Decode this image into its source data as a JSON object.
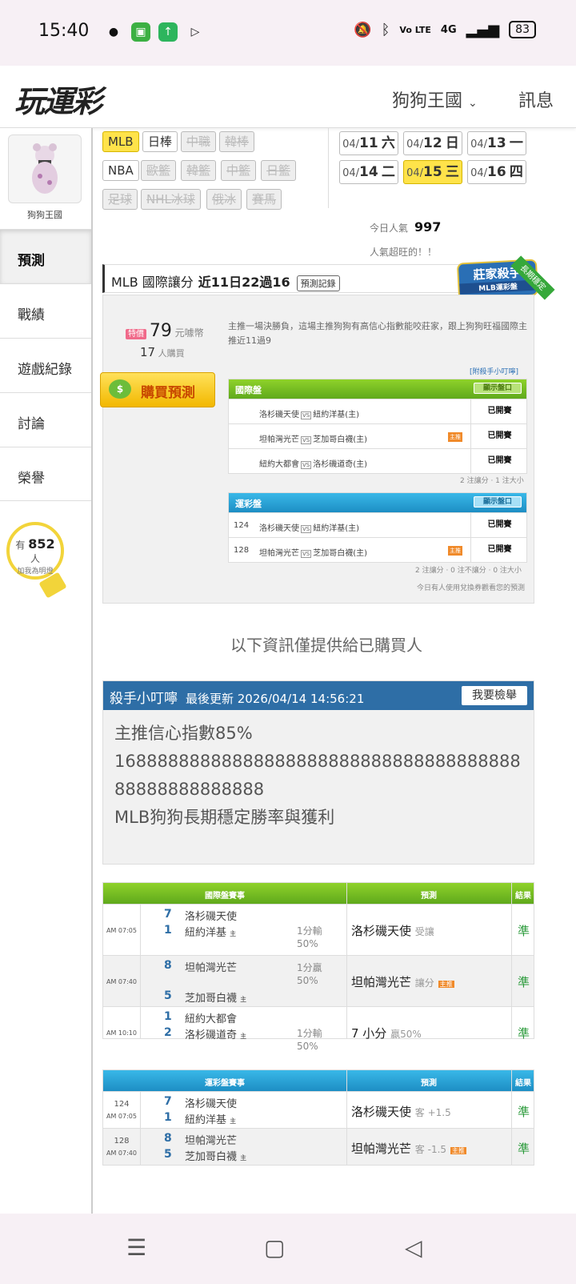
{
  "status": {
    "time": "15:40",
    "battery": "83",
    "network": "4G",
    "volte": "Vo LTE"
  },
  "header": {
    "logo": "玩運彩",
    "user": "狗狗王國",
    "messages": "訊息"
  },
  "sidebar": {
    "avatar_name": "狗狗王國",
    "items": [
      "預測",
      "戰績",
      "遊戲紀錄",
      "討論",
      "榮譽"
    ],
    "bulb_prefix": "有",
    "bulb_count": "852",
    "bulb_suffix": "人",
    "bulb_sub": "加我為明燈"
  },
  "leagues": [
    {
      "label": "MLB",
      "state": "on"
    },
    {
      "label": "日棒",
      "state": "normal"
    },
    {
      "label": "中職",
      "state": "disabled"
    },
    {
      "label": "韓棒",
      "state": "disabled"
    },
    {
      "label": "NBA",
      "state": "normal"
    },
    {
      "label": "歐籃",
      "state": "disabled"
    },
    {
      "label": "韓籃",
      "state": "disabled"
    },
    {
      "label": "中籃",
      "state": "disabled"
    },
    {
      "label": "日籃",
      "state": "disabled"
    },
    {
      "label": "足球",
      "state": "disabled"
    },
    {
      "label": "NHL冰球",
      "state": "disabled"
    },
    {
      "label": "俄冰",
      "state": "disabled"
    },
    {
      "label": "賽馬",
      "state": "disabled"
    }
  ],
  "dates": [
    {
      "md": "04/",
      "d": "11",
      "wd": "六"
    },
    {
      "md": "04/",
      "d": "12",
      "wd": "日"
    },
    {
      "md": "04/",
      "d": "13",
      "wd": "一"
    },
    {
      "md": "04/",
      "d": "14",
      "wd": "二"
    },
    {
      "md": "04/",
      "d": "15",
      "wd": "三",
      "active": true
    },
    {
      "md": "04/",
      "d": "16",
      "wd": "四"
    }
  ],
  "popularity": {
    "label": "今日人氣",
    "value": "997",
    "text": "人氣超旺的！！"
  },
  "title": {
    "league": "MLB 國際讓分",
    "record": "近11日22過16",
    "record_btn": "預測記錄",
    "badge": "莊家殺手",
    "badge_sub": "MLB運彩盤",
    "ribbon": "長期穩定"
  },
  "pred": {
    "price_tag": "特價",
    "price": "79",
    "price_unit": "元噱幣",
    "buyers": "17",
    "buyers_unit": "人購買",
    "buy_btn": "購買預測",
    "intro": "主推一場決勝負，這場主推狗狗有高信心指數能咬莊家，跟上狗狗旺福國際主推近11過9",
    "tip_link": "[附殺手小叮嚀]",
    "intl_title": "國際盤",
    "show_btn": "顯示盤口",
    "intl_rows": [
      {
        "away": "洛杉磯天使",
        "home": "紐約洋基(主)",
        "status": "已開賽",
        "hot": ""
      },
      {
        "away": "坦帕灣光芒",
        "home": "芝加哥白襪(主)",
        "status": "已開賽",
        "hot": "主推"
      },
      {
        "away": "紐約大都會",
        "home": "洛杉磯道奇(主)",
        "status": "已開賽",
        "hot": ""
      }
    ],
    "intl_note": "2 注讓分 · 1 注大小",
    "lottery_title": "運彩盤",
    "lottery_rows": [
      {
        "num": "124",
        "away": "洛杉磯天使",
        "home": "紐約洋基(主)",
        "status": "已開賽",
        "hot": ""
      },
      {
        "num": "128",
        "away": "坦帕灣光芒",
        "home": "芝加哥白襪(主)",
        "status": "已開賽",
        "hot": "主推"
      }
    ],
    "lottery_note": "2 注讓分 · 0 注不讓分 · 0 注大小",
    "coupon_note": "今日有人使用兌換券觀看您的預測"
  },
  "only_text": "以下資訊僅提供給已購買人",
  "tip": {
    "title": "殺手小叮嚀",
    "updated": "最後更新 2026/04/14 14:56:21",
    "report": "我要檢舉",
    "line1": "主推信心指數85%",
    "line2": "1688888888888888888888888888888888888888888888888888",
    "line3": "MLB狗狗長期穩定勝率與獲利"
  },
  "intl_results": {
    "head_event": "國際盤賽事",
    "head_pred": "預測",
    "head_res": "結果",
    "rows": [
      {
        "time": "AM 07:05",
        "s1": "7",
        "t1": "洛杉磯天使",
        "s2": "1",
        "t2": "紐約洋基",
        "home": "主",
        "odds": "1分輸",
        "odds2": "50%",
        "pred": "洛杉磯天使",
        "pred_sub": "受讓",
        "hot": "",
        "res": "準"
      },
      {
        "time": "AM 07:40",
        "s1": "8",
        "t1": "坦帕灣光芒",
        "s2": "5",
        "t2": "芝加哥白襪",
        "home": "主",
        "odds": "1分贏",
        "odds2": "50%",
        "pred": "坦帕灣光芒",
        "pred_sub": "讓分",
        "hot": "主推",
        "res": "準"
      },
      {
        "time": "AM 10:10",
        "s1": "1",
        "t1": "紐約大都會",
        "s2": "2",
        "t2": "洛杉磯道奇",
        "home": "主",
        "odds": "1分輸",
        "odds2": "50%",
        "pred": "7 小分",
        "pred_sub": "贏50%",
        "hot": "",
        "res": "準"
      }
    ]
  },
  "lottery_results": {
    "head_event": "運彩盤賽事",
    "head_pred": "預測",
    "head_res": "結果",
    "rows": [
      {
        "num": "124",
        "time": "AM 07:05",
        "s1": "7",
        "t1": "洛杉磯天使",
        "s2": "1",
        "t2": "紐約洋基",
        "home": "主",
        "pred": "洛杉磯天使",
        "pred_sub": "客 +1.5",
        "hot": "",
        "res": "準"
      },
      {
        "num": "128",
        "time": "AM 07:40",
        "s1": "8",
        "t1": "坦帕灣光芒",
        "s2": "5",
        "t2": "芝加哥白襪",
        "home": "主",
        "pred": "坦帕灣光芒",
        "pred_sub": "客 -1.5",
        "hot": "主推",
        "res": "準"
      }
    ]
  }
}
